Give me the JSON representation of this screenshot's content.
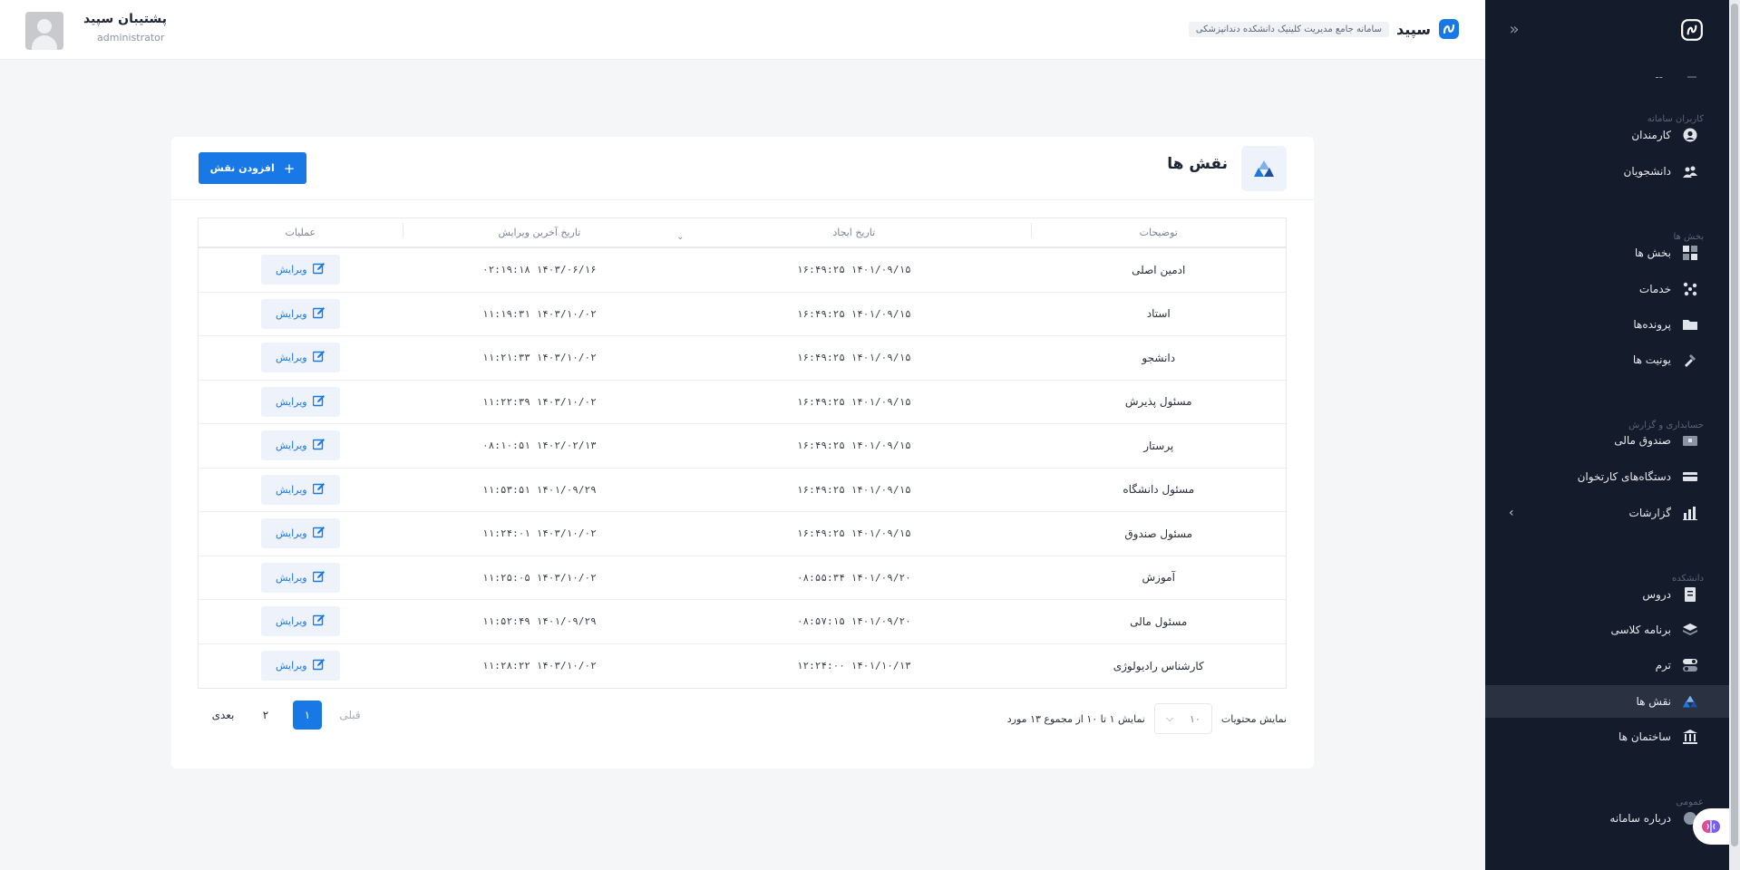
{
  "brand": {
    "name": "سپید",
    "subtitle": "سامانه جامع مدیریت کلینیک دانشکده دندانپزشکی"
  },
  "user": {
    "name": "پشتیبان سپید",
    "role": "administrator"
  },
  "sidebar": {
    "collapse_icon": "double-chevron-icon",
    "top_dash": "--",
    "sections": [
      {
        "label": "کاربران سامانه"
      },
      {
        "label": "بخش ها"
      },
      {
        "label": "حسابداری و گزارش"
      },
      {
        "label": "دانشکده"
      },
      {
        "label": "عمومی"
      }
    ],
    "items": [
      {
        "label": "کارمندان",
        "icon": "user-circle-icon"
      },
      {
        "label": "دانشجویان",
        "icon": "users-icon"
      },
      {
        "label": "بخش ها",
        "icon": "grid-icon"
      },
      {
        "label": "خدمات",
        "icon": "services-icon"
      },
      {
        "label": "پرونده‌ها",
        "icon": "folder-icon"
      },
      {
        "label": "یونیت ها",
        "icon": "unit-icon"
      },
      {
        "label": "صندوق مالی",
        "icon": "cashbox-icon"
      },
      {
        "label": "دستگاه‌های کارتخوان",
        "icon": "card-reader-icon"
      },
      {
        "label": "گزارشات",
        "icon": "chart-icon"
      },
      {
        "label": "دروس",
        "icon": "book-icon"
      },
      {
        "label": "برنامه کلاسی",
        "icon": "layers-icon"
      },
      {
        "label": "ترم",
        "icon": "toggle-icon"
      },
      {
        "label": "نقش ها",
        "icon": "roles-icon"
      },
      {
        "label": "ساختمان ها",
        "icon": "building-icon"
      },
      {
        "label": "درباره سامانه",
        "icon": "info-icon"
      }
    ],
    "active_index": 12
  },
  "page": {
    "title": "نقش ها",
    "add_button": "افزودن نقش",
    "columns": [
      "توضیحات",
      "تاریخ ایجاد",
      "تاریخ آخرین ویرایش",
      "عملیات"
    ],
    "edit_label": "ویرایش",
    "rows": [
      {
        "desc": "ادمین اصلی",
        "created": "۱۶:۴۹:۲۵ ۱۴۰۱/۰۹/۱۵",
        "edited": "۰۲:۱۹:۱۸ ۱۴۰۳/۰۶/۱۶"
      },
      {
        "desc": "استاد",
        "created": "۱۶:۴۹:۲۵ ۱۴۰۱/۰۹/۱۵",
        "edited": "۱۱:۱۹:۳۱ ۱۴۰۳/۱۰/۰۲"
      },
      {
        "desc": "دانشجو",
        "created": "۱۶:۴۹:۲۵ ۱۴۰۱/۰۹/۱۵",
        "edited": "۱۱:۲۱:۳۳ ۱۴۰۳/۱۰/۰۲"
      },
      {
        "desc": "مسئول پذیرش",
        "created": "۱۶:۴۹:۲۵ ۱۴۰۱/۰۹/۱۵",
        "edited": "۱۱:۲۲:۳۹ ۱۴۰۳/۱۰/۰۲"
      },
      {
        "desc": "پرستار",
        "created": "۱۶:۴۹:۲۵ ۱۴۰۱/۰۹/۱۵",
        "edited": "۰۸:۱۰:۵۱ ۱۴۰۲/۰۲/۱۳"
      },
      {
        "desc": "مسئول دانشگاه",
        "created": "۱۶:۴۹:۲۵ ۱۴۰۱/۰۹/۱۵",
        "edited": "۱۱:۵۳:۵۱ ۱۴۰۱/۰۹/۲۹"
      },
      {
        "desc": "مسئول صندوق",
        "created": "۱۶:۴۹:۲۵ ۱۴۰۱/۰۹/۱۵",
        "edited": "۱۱:۲۴:۰۱ ۱۴۰۳/۱۰/۰۲"
      },
      {
        "desc": "آموزش",
        "created": "۰۸:۵۵:۳۴ ۱۴۰۱/۰۹/۲۰",
        "edited": "۱۱:۲۵:۰۵ ۱۴۰۳/۱۰/۰۲"
      },
      {
        "desc": "مسئول مالی",
        "created": "۰۸:۵۷:۱۵ ۱۴۰۱/۰۹/۲۰",
        "edited": "۱۱:۵۲:۴۹ ۱۴۰۱/۰۹/۲۹"
      },
      {
        "desc": "کارشناس رادیولوژی",
        "created": "۱۲:۲۴:۰۰ ۱۴۰۱/۱۰/۱۳",
        "edited": "۱۱:۲۸:۲۲ ۱۴۰۳/۱۰/۰۲"
      }
    ],
    "pagination": {
      "show_label": "نمایش محتویات",
      "page_size": "۱۰",
      "summary": "نمایش ۱ تا ۱۰ از مجموع ۱۳ مورد",
      "prev": "قبلی",
      "pages": [
        "۱",
        "۲"
      ],
      "current_index": 0,
      "next": "بعدی"
    }
  }
}
